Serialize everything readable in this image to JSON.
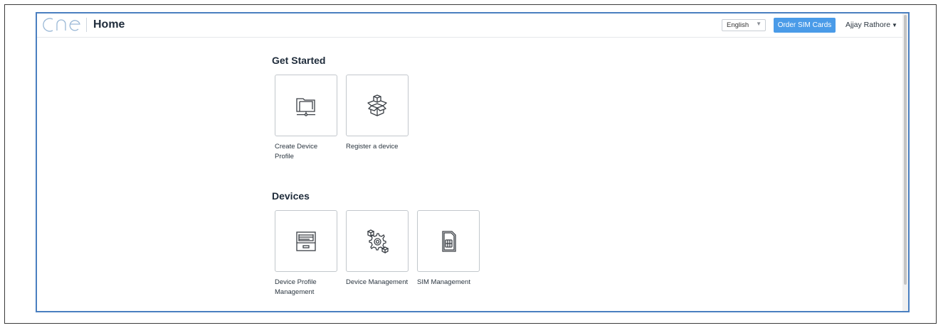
{
  "header": {
    "title": "Home",
    "language": "English",
    "order_button": "Order SIM Cards",
    "user_name": "Ajjay Rathore"
  },
  "sections": [
    {
      "title": "Get Started",
      "tiles": [
        {
          "label": "Create Device Profile",
          "icon": "folder-network-icon"
        },
        {
          "label": "Register a device",
          "icon": "open-box-icon"
        }
      ]
    },
    {
      "title": "Devices",
      "tiles": [
        {
          "label": "Device Profile Management",
          "icon": "file-cabinet-icon"
        },
        {
          "label": "Device Management",
          "icon": "gear-devices-icon"
        },
        {
          "label": "SIM Management",
          "icon": "sim-card-icon"
        }
      ]
    }
  ],
  "colors": {
    "accent": "#4a9be8",
    "window_border": "#4a7fc0"
  }
}
